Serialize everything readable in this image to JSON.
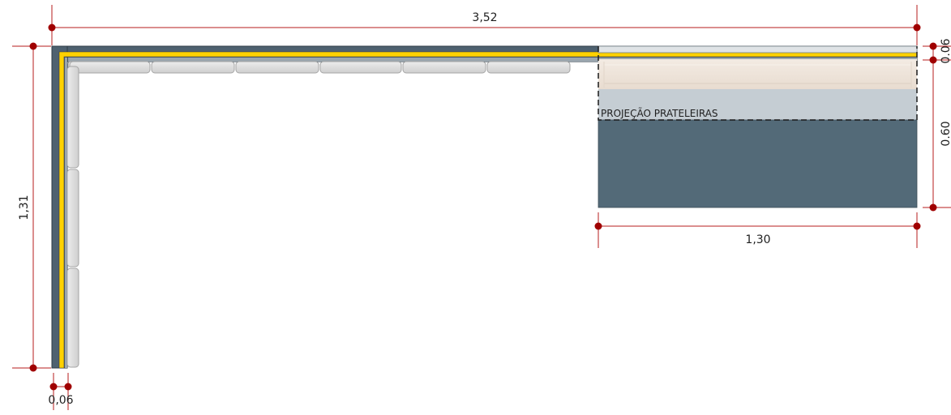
{
  "dimensions": {
    "total_width": "3,52",
    "total_height": "1,31",
    "wall_thickness": "0,06",
    "cabinet_width": "1,30",
    "top_offset": "0.06",
    "cabinet_depth": "0.60"
  },
  "labels": {
    "shelf_projection": "PROJEÇÃO PRATELEIRAS"
  },
  "colors": {
    "dimension_line": "#b71c1c",
    "wall_fill": "#4e6170",
    "accent_strip": "#ffd200",
    "tile_fill": "#d9d9d9",
    "cabinet_fill": "#536a78",
    "shelf_fill": "#c5cdd3",
    "wood_fill": "#efe5dc"
  }
}
